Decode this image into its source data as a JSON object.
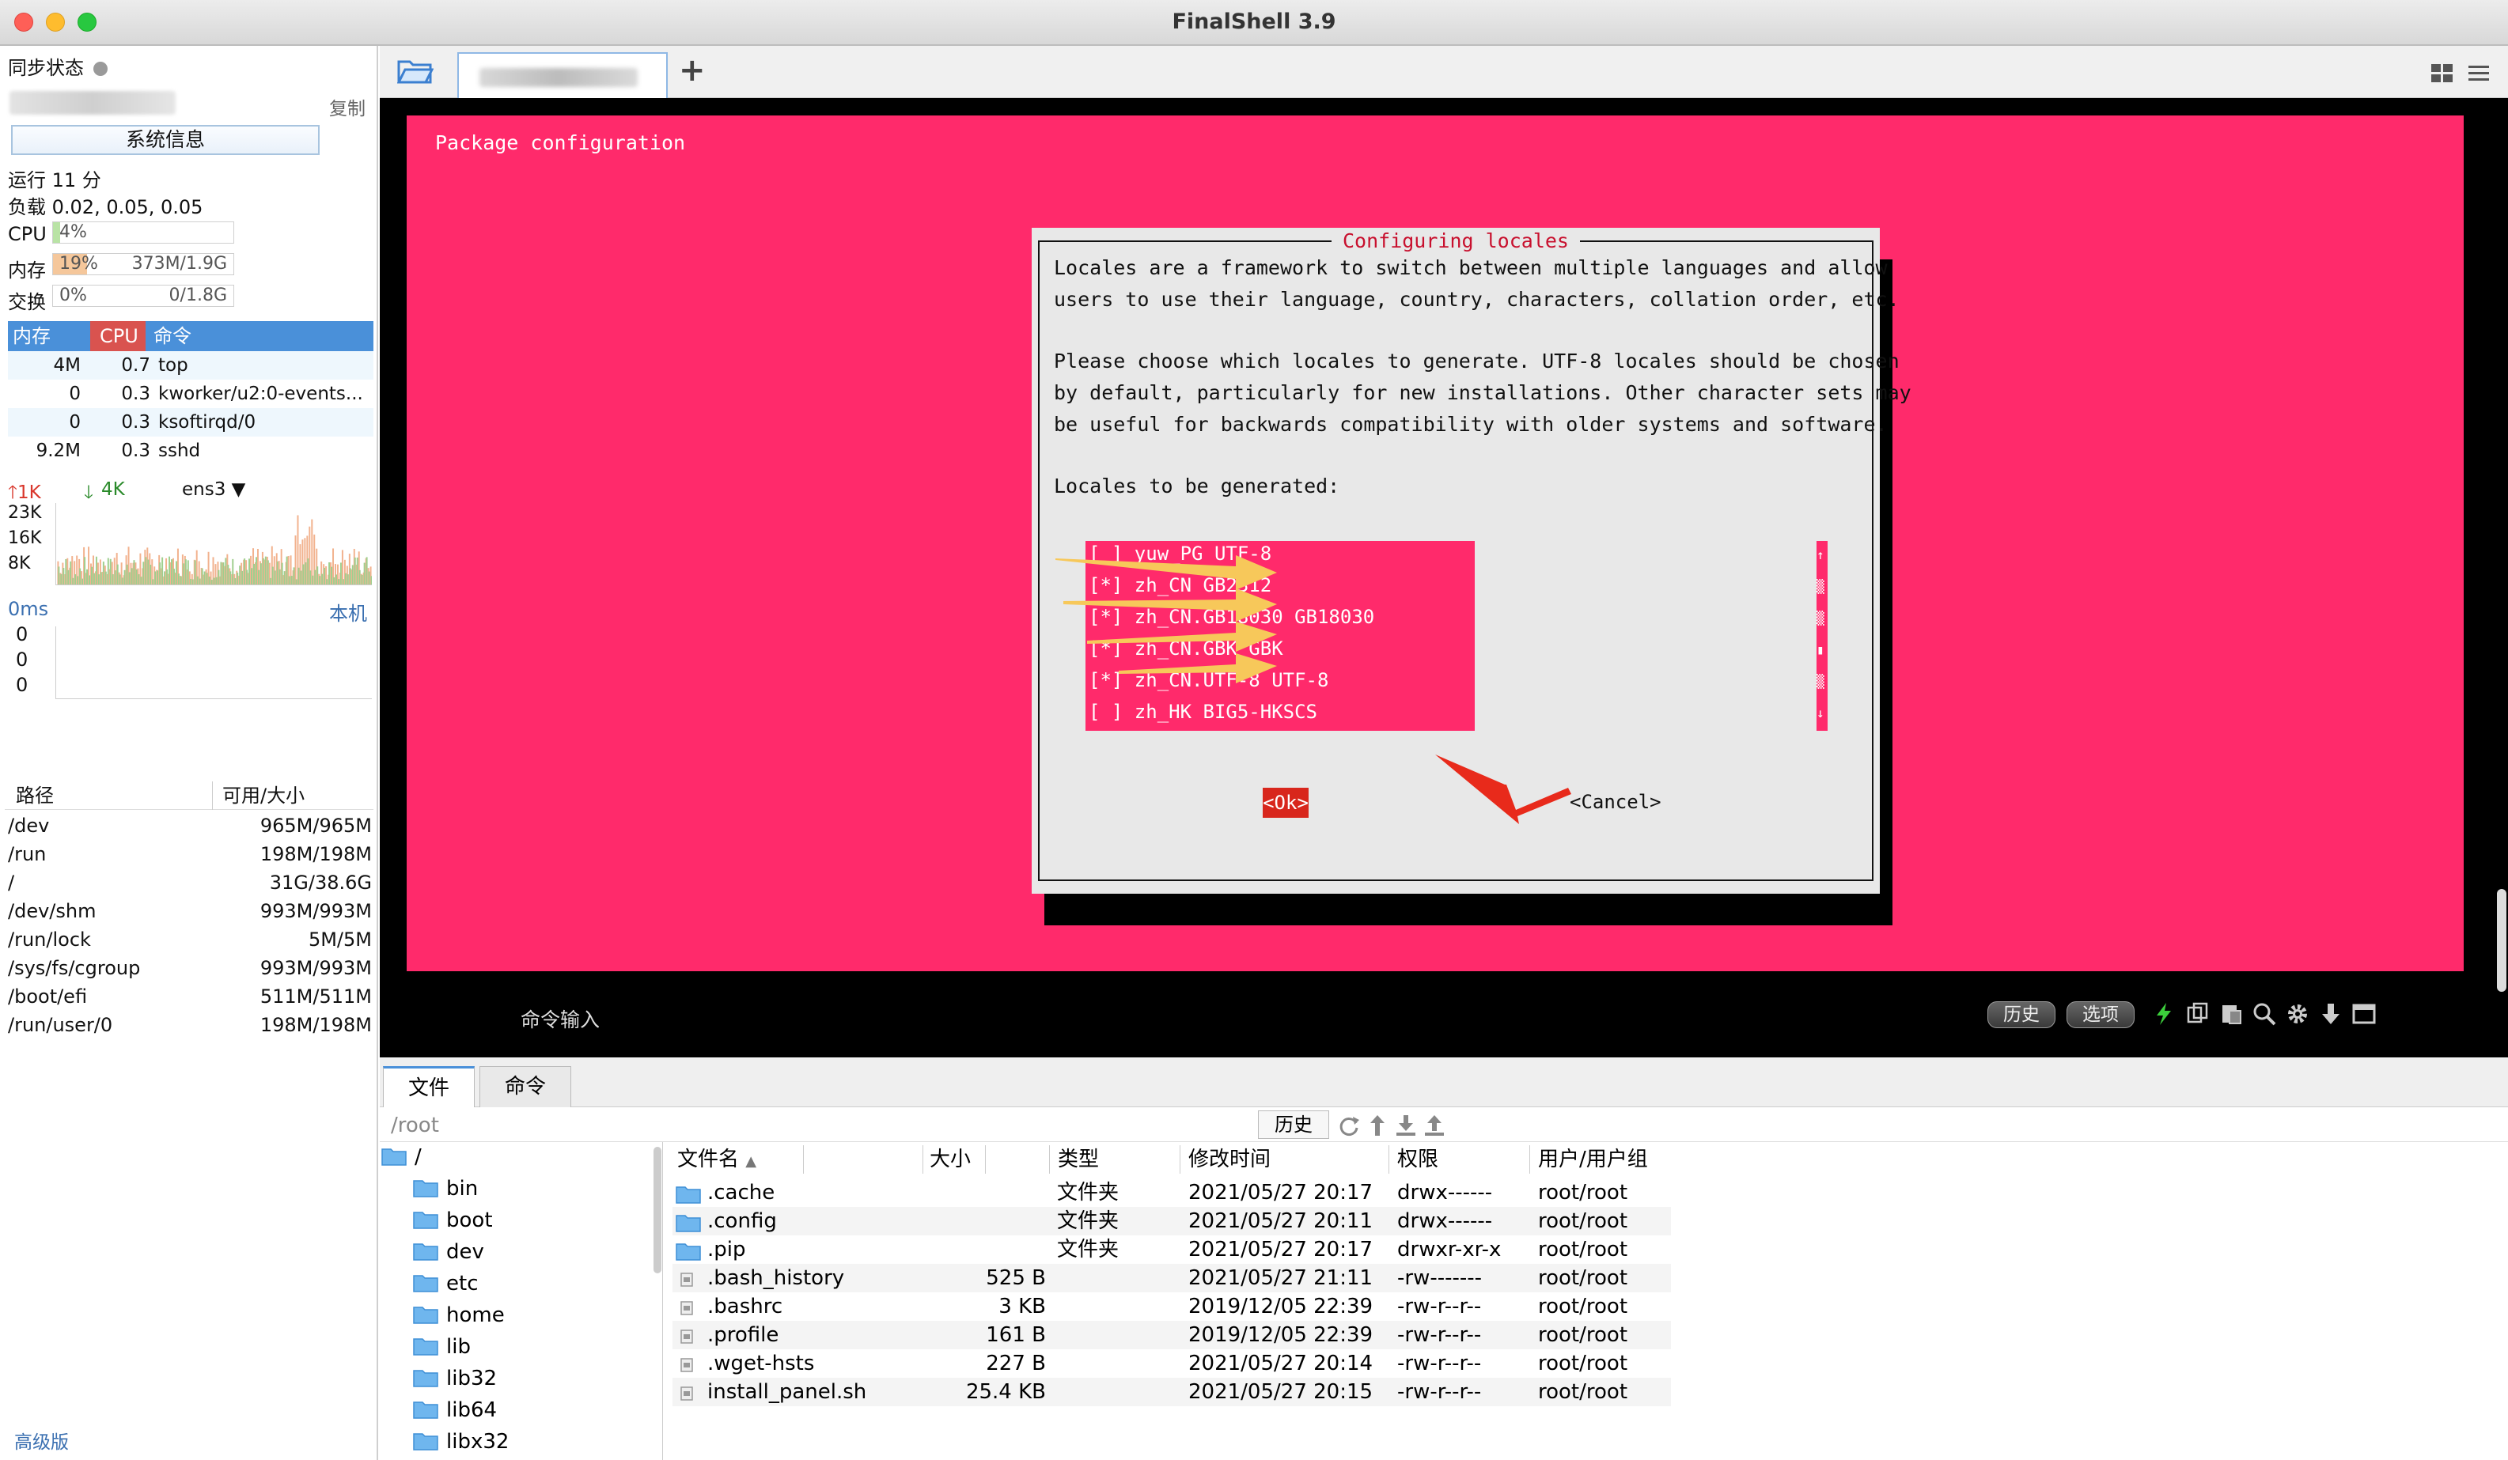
{
  "window": {
    "title": "FinalShell 3.9"
  },
  "left": {
    "sync_label": "同步状态",
    "copy_label": "复制",
    "sysinfo_button": "系统信息",
    "uptime": "运行 11 分",
    "load": "负载 0.02, 0.05, 0.05",
    "cpu": {
      "label": "CPU",
      "value": "4%",
      "fraction": 0.04
    },
    "mem": {
      "label": "内存",
      "value": "19%",
      "detail": "373M/1.9G",
      "fraction": 0.19
    },
    "swap": {
      "label": "交换",
      "value": "0%",
      "detail": "0/1.8G",
      "fraction": 0.0
    },
    "proc_headers": [
      "内存",
      "CPU",
      "命令"
    ],
    "processes": [
      {
        "mem": "4M",
        "cpu": "0.7",
        "cmd": "top"
      },
      {
        "mem": "0",
        "cpu": "0.3",
        "cmd": "kworker/u2:0-events..."
      },
      {
        "mem": "0",
        "cpu": "0.3",
        "cmd": "ksoftirqd/0"
      },
      {
        "mem": "9.2M",
        "cpu": "0.3",
        "cmd": "sshd"
      }
    ],
    "net": {
      "up": "1K",
      "down": "4K",
      "iface": "ens3",
      "scale": [
        "23K",
        "16K",
        "8K"
      ]
    },
    "ping": {
      "ms": "0ms",
      "host": "本机",
      "values": [
        "0",
        "0",
        "0"
      ]
    },
    "disk_headers": [
      "路径",
      "可用/大小"
    ],
    "disks": [
      {
        "path": "/dev",
        "size": "965M/965M"
      },
      {
        "path": "/run",
        "size": "198M/198M"
      },
      {
        "path": "/",
        "size": "31G/38.6G"
      },
      {
        "path": "/dev/shm",
        "size": "993M/993M"
      },
      {
        "path": "/run/lock",
        "size": "5M/5M"
      },
      {
        "path": "/sys/fs/cgroup",
        "size": "993M/993M"
      },
      {
        "path": "/boot/efi",
        "size": "511M/511M"
      },
      {
        "path": "/run/user/0",
        "size": "198M/198M"
      }
    ],
    "advanced": "高级版"
  },
  "terminal": {
    "pkg_title": "Package configuration",
    "dialog_title": "Configuring locales",
    "lines": [
      "Locales are a framework to switch between multiple languages and allow",
      "users to use their language, country, characters, collation order, etc.",
      "",
      "Please choose which locales to generate. UTF-8 locales should be chosen",
      "by default, particularly for new installations. Other character sets may",
      "be useful for backwards compatibility with older systems and software.",
      "",
      "Locales to be generated:"
    ],
    "locales": [
      "[ ] yuw_PG UTF-8",
      "[*] zh_CN GB2312",
      "[*] zh_CN.GB18030 GB18030",
      "[*] zh_CN.GBK GBK",
      "[*] zh_CN.UTF-8 UTF-8",
      "[ ] zh_HK BIG5-HKSCS"
    ],
    "ok": "<Ok>",
    "cancel": "<Cancel>",
    "cmd_input": "命令输入",
    "history_btn": "历史",
    "options_btn": "选项"
  },
  "files": {
    "tabs": [
      "文件",
      "命令"
    ],
    "path": "/root",
    "history_btn": "历史",
    "tree": [
      "/",
      "bin",
      "boot",
      "dev",
      "etc",
      "home",
      "lib",
      "lib32",
      "lib64",
      "libx32"
    ],
    "headers": [
      "文件名",
      "大小",
      "类型",
      "修改时间",
      "权限",
      "用户/用户组"
    ],
    "rows": [
      {
        "name": ".cache",
        "size": "",
        "type": "文件夹",
        "mtime": "2021/05/27 20:17",
        "perm": "drwx------",
        "owner": "root/root",
        "kind": "folder"
      },
      {
        "name": ".config",
        "size": "",
        "type": "文件夹",
        "mtime": "2021/05/27 20:11",
        "perm": "drwx------",
        "owner": "root/root",
        "kind": "folder"
      },
      {
        "name": ".pip",
        "size": "",
        "type": "文件夹",
        "mtime": "2021/05/27 20:17",
        "perm": "drwxr-xr-x",
        "owner": "root/root",
        "kind": "folder"
      },
      {
        "name": ".bash_history",
        "size": "525 B",
        "type": "",
        "mtime": "2021/05/27 21:11",
        "perm": "-rw-------",
        "owner": "root/root",
        "kind": "file"
      },
      {
        "name": ".bashrc",
        "size": "3 KB",
        "type": "",
        "mtime": "2019/12/05 22:39",
        "perm": "-rw-r--r--",
        "owner": "root/root",
        "kind": "file"
      },
      {
        "name": ".profile",
        "size": "161 B",
        "type": "",
        "mtime": "2019/12/05 22:39",
        "perm": "-rw-r--r--",
        "owner": "root/root",
        "kind": "file"
      },
      {
        "name": ".wget-hsts",
        "size": "227 B",
        "type": "",
        "mtime": "2021/05/27 20:14",
        "perm": "-rw-r--r--",
        "owner": "root/root",
        "kind": "file"
      },
      {
        "name": "install_panel.sh",
        "size": "25.4 KB",
        "type": "",
        "mtime": "2021/05/27 20:15",
        "perm": "-rw-r--r--",
        "owner": "root/root",
        "kind": "file"
      }
    ]
  },
  "colors": {
    "terminal_bg": "#ff2a6b",
    "accent": "#4a90d9",
    "ok_button": "#d8261c",
    "arrow": "#f7c85a"
  }
}
